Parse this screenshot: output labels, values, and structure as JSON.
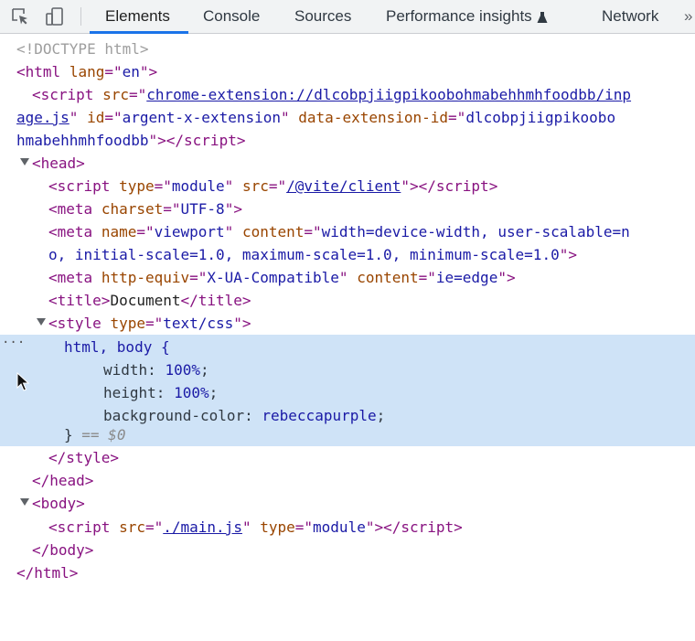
{
  "toolbar": {
    "tabs": [
      {
        "label": "Elements",
        "active": true
      },
      {
        "label": "Console"
      },
      {
        "label": "Sources"
      },
      {
        "label": "Performance insights"
      },
      {
        "label": "Network"
      }
    ],
    "more_label": "»",
    "accent_color": "#1a73e8"
  },
  "dom": {
    "doctype": "<!DOCTYPE html>",
    "html_open": {
      "tag": "html",
      "attr": "lang",
      "value": "en"
    },
    "ext_script": {
      "src_line1": "chrome-extension://dlcobpjiigpikoobohmabehhmhfoodbb/inp",
      "src_line2": "age.js",
      "id_value": "argent-x-extension",
      "data_attr": "data-extension-id",
      "data_value_line1": "dlcobpjiigpikoobo",
      "data_value_line2": "hmabehhmhfoodbb"
    },
    "vite_script": {
      "type": "module",
      "src": "/@vite/client"
    },
    "meta_charset": "UTF-8",
    "meta_viewport": {
      "name": "viewport",
      "content_line1": "width=device-width, user-scalable=n",
      "content_line2": "o, initial-scale=1.0, maximum-scale=1.0, minimum-scale=1.0"
    },
    "meta_compat": {
      "http_equiv": "X-UA-Compatible",
      "content": "ie=edge"
    },
    "title_text": "Document",
    "style_type": "text/css",
    "css": {
      "selector": "html, body {",
      "width_prop": "width",
      "width_val": "100%",
      "height_prop": "height",
      "height_val": "100%",
      "bg_prop": "background-color",
      "bg_val": "rebeccapurple",
      "close": "}",
      "eq_marker": "== $0"
    },
    "main_script": {
      "src": "./main.js",
      "type": "module"
    }
  },
  "selection_color": "#cfe3f7"
}
